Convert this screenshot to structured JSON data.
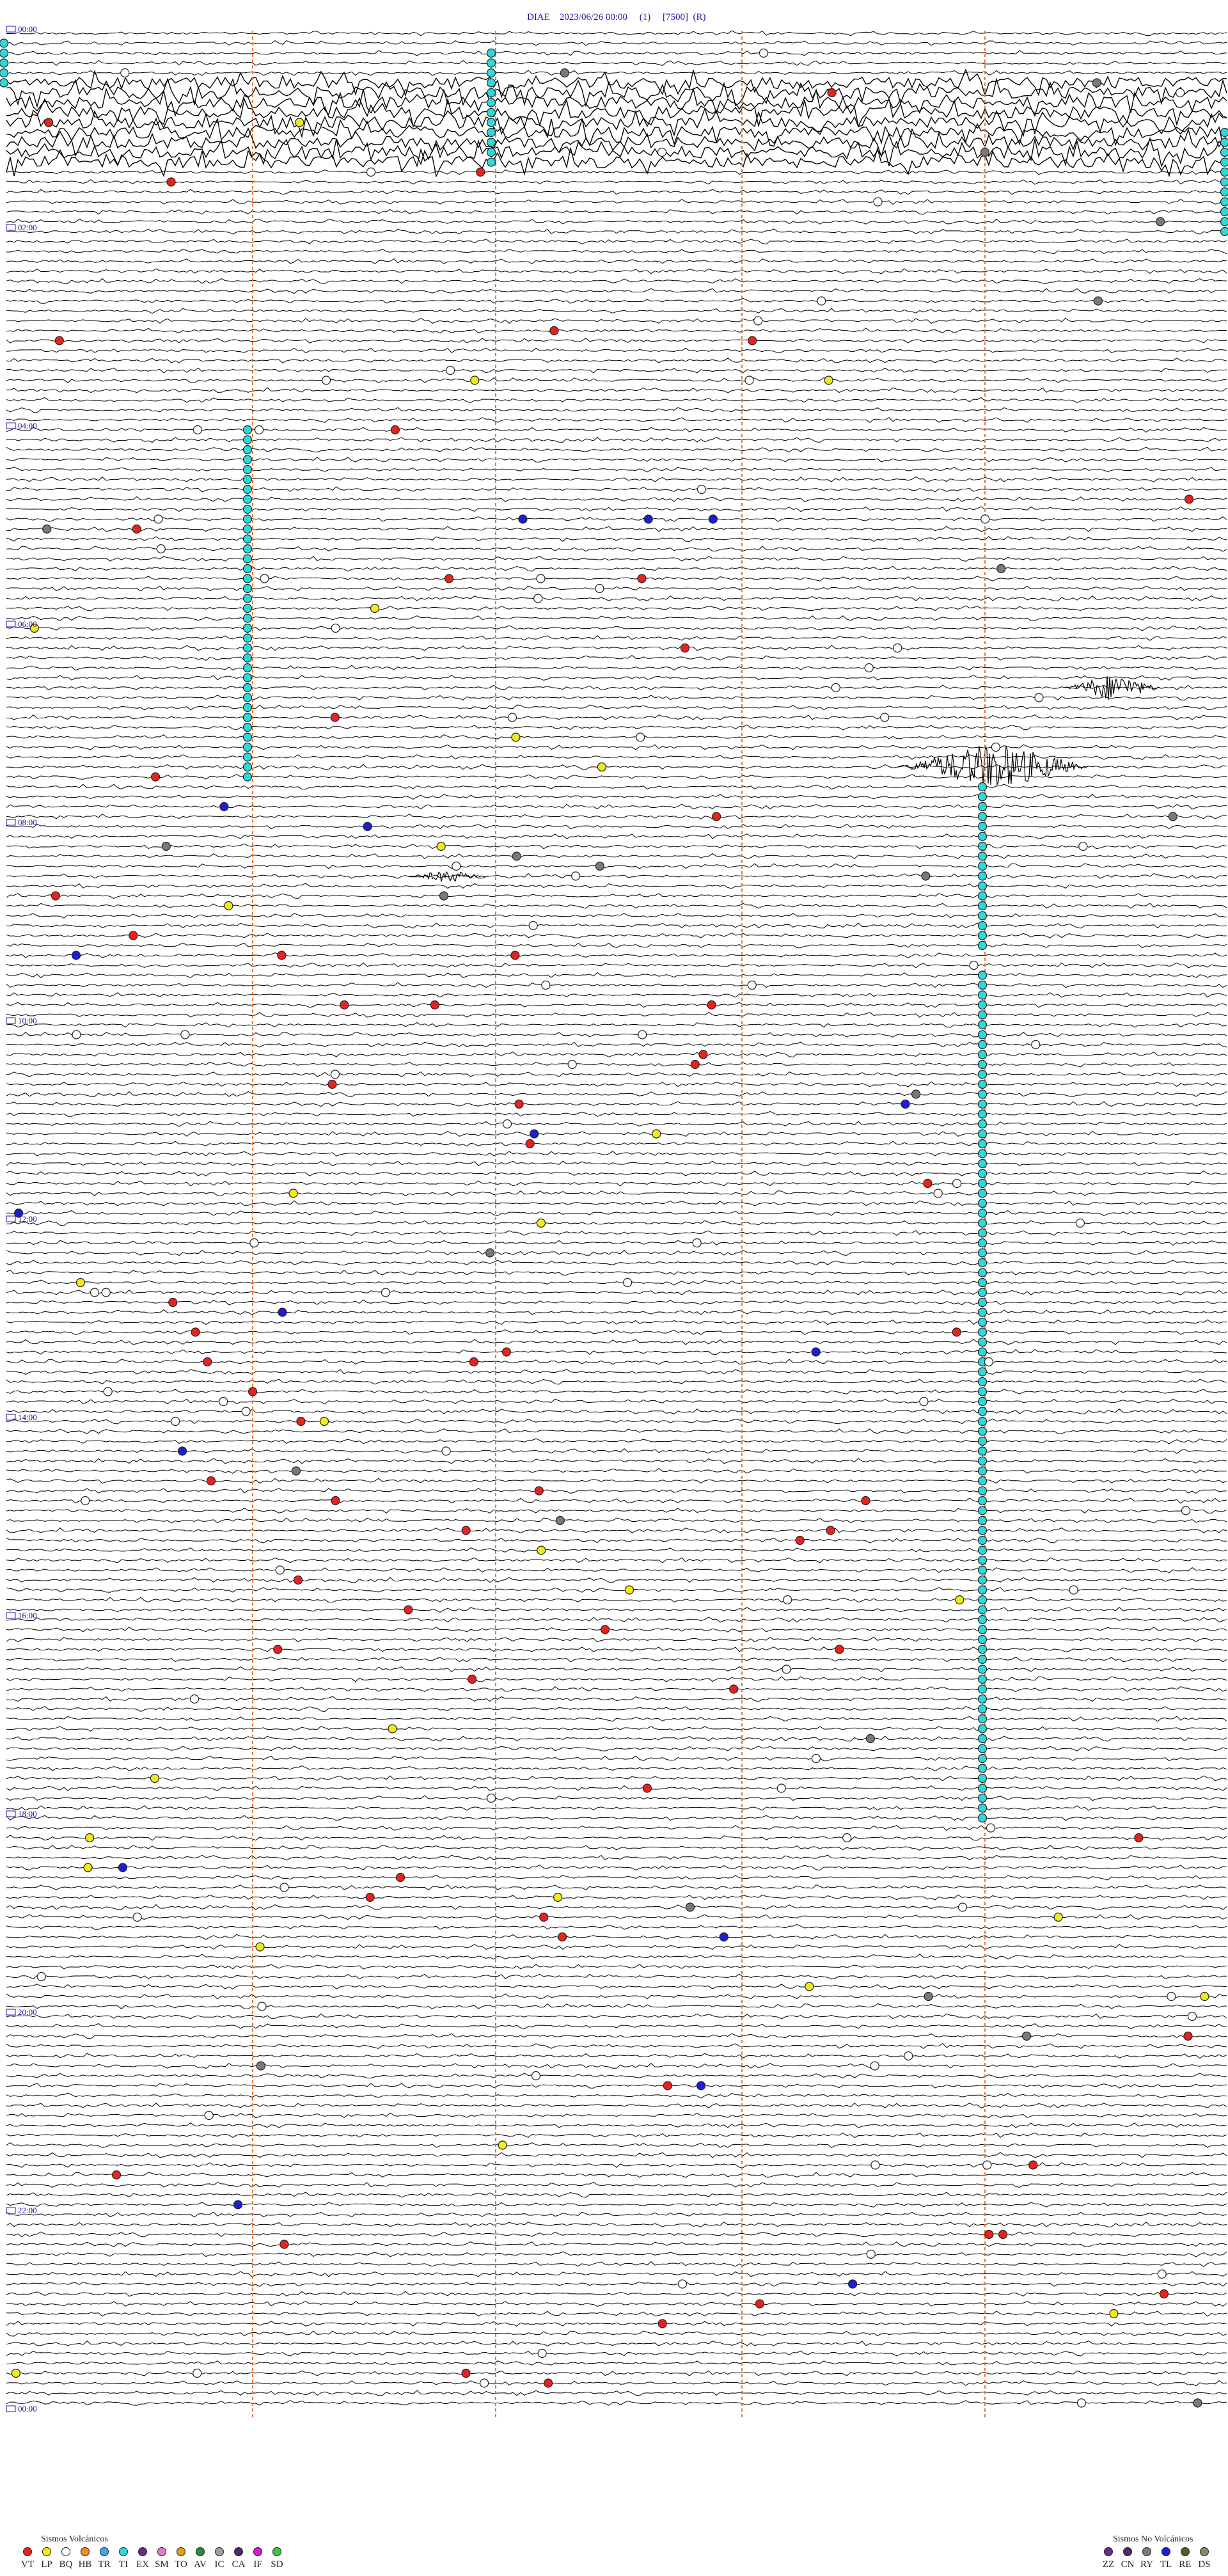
{
  "header": {
    "station": "DIAE",
    "datetime": "2023/06/26 00:00",
    "channel": "(1)",
    "scale": "[7500]",
    "flag": "(R)"
  },
  "time_labels": [
    "00:00",
    "02:00",
    "04:00",
    "06:00",
    "08:00",
    "10:00",
    "12:00",
    "14:00",
    "16:00",
    "18:00",
    "20:00",
    "22:00",
    "00:00"
  ],
  "legend_volcanic": {
    "title": "Sismos Volcánicos",
    "items": [
      {
        "code": "VT",
        "color": "#e8231e"
      },
      {
        "code": "LP",
        "color": "#f2ea1c"
      },
      {
        "code": "BQ",
        "color": "#ffffff"
      },
      {
        "code": "HB",
        "color": "#f28c1e"
      },
      {
        "code": "TR",
        "color": "#3fa9e6"
      },
      {
        "code": "TI",
        "color": "#2fd9d9"
      },
      {
        "code": "EX",
        "color": "#6a2a8a"
      },
      {
        "code": "SM",
        "color": "#e27ac9"
      },
      {
        "code": "TO",
        "color": "#d9a21e"
      },
      {
        "code": "AV",
        "color": "#2b8a3f"
      },
      {
        "code": "IC",
        "color": "#a0a0a0"
      },
      {
        "code": "CA",
        "color": "#4a2a6a"
      },
      {
        "code": "IF",
        "color": "#d41ec9"
      },
      {
        "code": "SD",
        "color": "#3fc93f"
      }
    ]
  },
  "legend_nonvolcanic": {
    "title": "Sismos No Volcánicos",
    "items": [
      {
        "code": "ZZ",
        "color": "#6a2a8a"
      },
      {
        "code": "CN",
        "color": "#4a2a6a"
      },
      {
        "code": "RY",
        "color": "#7a7a7a"
      },
      {
        "code": "TL",
        "color": "#1e1ed4"
      },
      {
        "code": "RE",
        "color": "#5a5a2a"
      },
      {
        "code": "DS",
        "color": "#8a8a6a"
      }
    ]
  }
}
